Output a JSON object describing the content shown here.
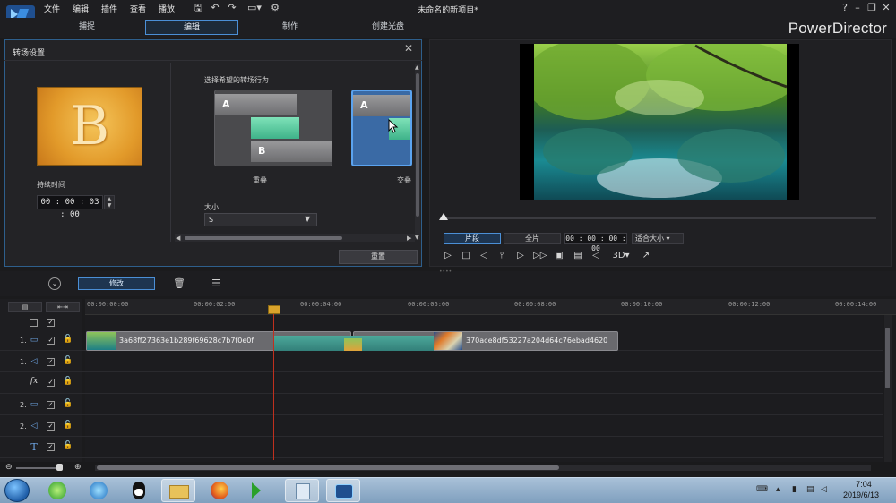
{
  "app": {
    "menu": [
      "文件",
      "编辑",
      "插件",
      "查看",
      "播放"
    ],
    "window_title": "未命名的新项目*",
    "brand": "PowerDirector",
    "help_label": "?",
    "modes": [
      "捕捉",
      "编辑",
      "制作",
      "创建光盘"
    ]
  },
  "transition_panel": {
    "title": "转场设置",
    "thumbnail_letter": "B",
    "duration_label": "持续时间",
    "duration_value": "00 : 00 : 03 : 00",
    "behavior_label": "选择希望的转场行为",
    "option1": {
      "a": "A",
      "b": "B",
      "label": "重叠"
    },
    "option2": {
      "a": "A",
      "label": "交叠"
    },
    "size_label": "大小",
    "size_value": "S",
    "reset_label": "重置"
  },
  "preview": {
    "tab_clip": "片段",
    "tab_movie": "全片",
    "timecode": "00 : 00 : 00 : 00",
    "fit_label": "适合大小",
    "mode_3d": "3D"
  },
  "timeline": {
    "modify_label": "修改",
    "ruler": [
      "00:00:00:00",
      "00:00:02:00",
      "00:00:04:00",
      "00:00:06:00",
      "00:00:08:00",
      "00:00:10:00",
      "00:00:12:00",
      "00:00:14:00"
    ],
    "tracks": [
      {
        "num": "1.",
        "kind": "video"
      },
      {
        "num": "1.",
        "kind": "audio"
      },
      {
        "num": "",
        "kind": "fx"
      },
      {
        "num": "2.",
        "kind": "video"
      },
      {
        "num": "2.",
        "kind": "audio"
      },
      {
        "num": "",
        "kind": "title"
      }
    ],
    "clip1_name": "3a68ff27363e1b289f69628c7b7f0e0f",
    "clip2_name": "370ace8df53227a204d64c76ebad4620"
  },
  "taskbar": {
    "time": "7:04",
    "date": "2019/6/13"
  },
  "colors": {
    "accent": "#4b8fd6",
    "playhead": "#c0301e",
    "transition": "#3fb38a"
  }
}
